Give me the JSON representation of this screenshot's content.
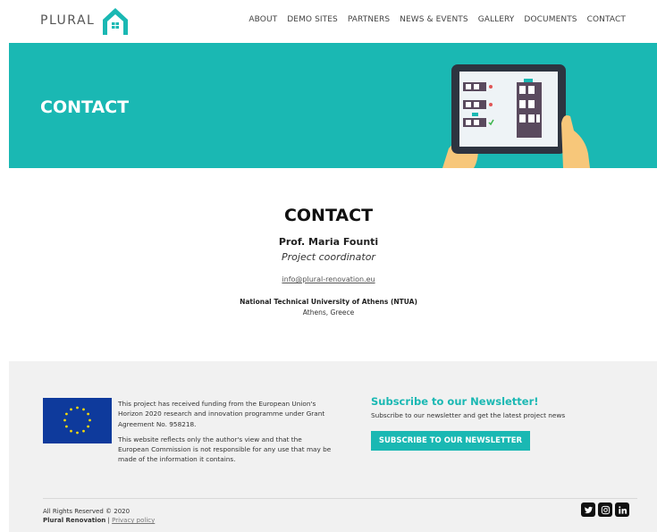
{
  "brand": {
    "name": "PLURAL",
    "accent": "#1ab8b3"
  },
  "nav": {
    "items": [
      {
        "label": "ABOUT"
      },
      {
        "label": "DEMO SITES"
      },
      {
        "label": "PARTNERS"
      },
      {
        "label": "NEWS & EVENTS"
      },
      {
        "label": "GALLERY"
      },
      {
        "label": "DOCUMENTS"
      },
      {
        "label": "CONTACT"
      }
    ]
  },
  "hero": {
    "title": "CONTACT",
    "illustration": "tablet-building-icon"
  },
  "contact": {
    "heading": "CONTACT",
    "name": "Prof. Maria Founti",
    "role": "Project coordinator",
    "email": "info@plural-renovation.eu",
    "organization": "National Technical University of Athens (NTUA)",
    "location": "Athens, Greece"
  },
  "footer": {
    "funding_text_1": "This project has received funding from the European Union's Horizon 2020 research and innovation programme under Grant Agreement No. 958218.",
    "funding_text_2": "This website reflects only the author's view and that the European Commission is not responsible for any use that may be made of the information it contains.",
    "newsletter_title": "Subscribe to our Newsletter!",
    "newsletter_desc": "Subscribe to our newsletter and get the latest project news",
    "newsletter_button": "SUBSCRIBE TO OUR NEWSLETTER",
    "copyright": "All Rights Reserved © 2020",
    "company": "Plural Renovation",
    "separator": "|",
    "privacy": "Privacy policy",
    "social_icons": [
      "twitter-icon",
      "instagram-icon",
      "linkedin-icon"
    ]
  }
}
